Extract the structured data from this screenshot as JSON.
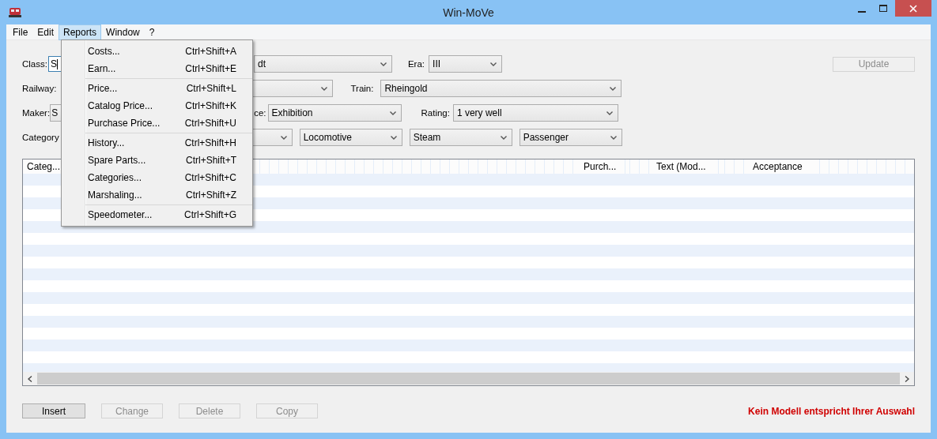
{
  "window": {
    "title": "Win-MoVe"
  },
  "menu_bar": [
    {
      "label": "File",
      "selected": false
    },
    {
      "label": "Edit",
      "selected": false
    },
    {
      "label": "Reports",
      "selected": true
    },
    {
      "label": "Window",
      "selected": false
    },
    {
      "label": "?",
      "selected": false
    }
  ],
  "reports_menu": [
    [
      {
        "label": "Costs...",
        "shortcut": "Ctrl+Shift+A"
      },
      {
        "label": "Earn...",
        "shortcut": "Ctrl+Shift+E"
      }
    ],
    [
      {
        "label": "Price...",
        "shortcut": "Ctrl+Shift+L"
      },
      {
        "label": "Catalog Price...",
        "shortcut": "Ctrl+Shift+K"
      },
      {
        "label": "Purchase Price...",
        "shortcut": "Ctrl+Shift+U"
      }
    ],
    [
      {
        "label": "History...",
        "shortcut": "Ctrl+Shift+H"
      },
      {
        "label": "Spare Parts...",
        "shortcut": "Ctrl+Shift+T"
      },
      {
        "label": "Categories...",
        "shortcut": "Ctrl+Shift+C"
      },
      {
        "label": "Marshaling...",
        "shortcut": "Ctrl+Shift+Z"
      }
    ],
    [
      {
        "label": "Speedometer...",
        "shortcut": "Ctrl+Shift+G"
      }
    ]
  ],
  "form": {
    "rows": [
      [
        {
          "label": "Class:",
          "kind": "input",
          "value": "S"
        },
        {
          "kind": "select",
          "value": "dt"
        },
        {
          "label": "Era:",
          "kind": "select",
          "value": "III"
        }
      ],
      [
        {
          "label": "Railway:",
          "kind": "select"
        },
        {
          "label": "Train:",
          "kind": "select",
          "value": "Rheingold"
        }
      ],
      [
        {
          "label": "Maker:",
          "kind": "select",
          "value": "S"
        },
        {
          "label": "ce:",
          "kind": "select",
          "value": "Exhibition"
        },
        {
          "label": "Rating:",
          "kind": "select",
          "value": "1 very well"
        }
      ],
      [
        {
          "label": "Category",
          "kind": "select"
        },
        {
          "kind": "select",
          "value": "Locomotive"
        },
        {
          "kind": "select",
          "value": "Steam"
        },
        {
          "kind": "select",
          "value": "Passenger"
        }
      ]
    ],
    "update_button": {
      "label": "Update",
      "disabled": true
    }
  },
  "table": {
    "columns": [
      "Categ...",
      "Purch...",
      "Text (Mod...",
      "Acceptance"
    ]
  },
  "buttons": [
    {
      "label": "Insert",
      "disabled": false
    },
    {
      "label": "Change",
      "disabled": true
    },
    {
      "label": "Delete",
      "disabled": true
    },
    {
      "label": "Copy",
      "disabled": true
    }
  ],
  "status_message": "Kein Modell entspricht Ihrer Auswahl"
}
